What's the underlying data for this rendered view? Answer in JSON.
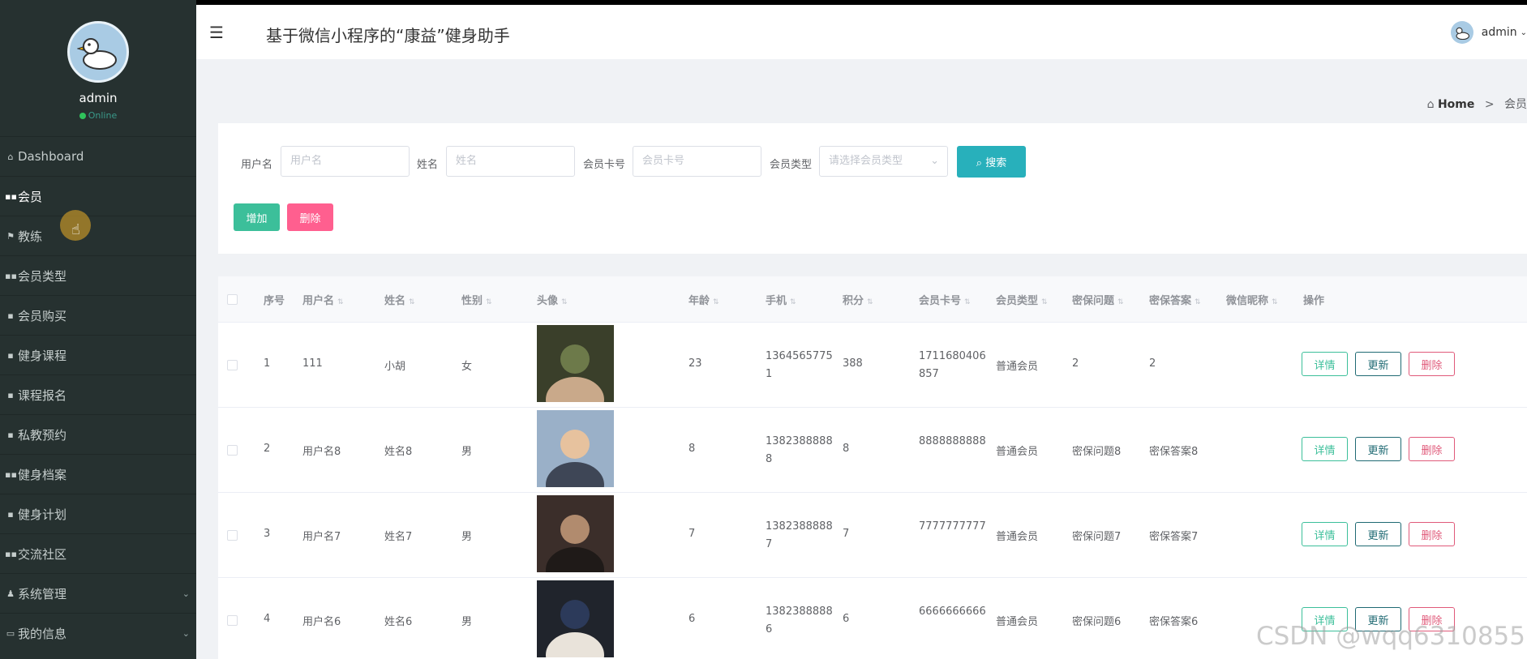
{
  "app": {
    "title": "基于微信小程序的“康益”健身助手",
    "user": "admin",
    "status": "Online",
    "watermark": "CSDN @wqq6310855"
  },
  "breadcrumb": {
    "home": "Home",
    "sep": ">",
    "current": "会员"
  },
  "sidebar": {
    "items": [
      {
        "label": "Dashboard",
        "icon": "home-icon",
        "glyph": "⌂"
      },
      {
        "label": "会员",
        "icon": "grid-icon",
        "glyph": "▪▪"
      },
      {
        "label": "教练",
        "icon": "flag-icon",
        "glyph": "⚑"
      },
      {
        "label": "会员类型",
        "icon": "grid-icon",
        "glyph": "▪▪"
      },
      {
        "label": "会员购买",
        "icon": "doc-icon",
        "glyph": "▪"
      },
      {
        "label": "健身课程",
        "icon": "chat-icon",
        "glyph": "▪"
      },
      {
        "label": "课程报名",
        "icon": "doc-icon",
        "glyph": "▪"
      },
      {
        "label": "私教预约",
        "icon": "pen-icon",
        "glyph": "▪"
      },
      {
        "label": "健身档案",
        "icon": "grid-icon",
        "glyph": "▪▪"
      },
      {
        "label": "健身计划",
        "icon": "lock-icon",
        "glyph": "▪"
      },
      {
        "label": "交流社区",
        "icon": "grid-icon",
        "glyph": "▪▪"
      },
      {
        "label": "系统管理",
        "icon": "user-icon",
        "glyph": "♟"
      },
      {
        "label": "我的信息",
        "icon": "card-icon",
        "glyph": "▭"
      }
    ]
  },
  "search": {
    "username_label": "用户名",
    "username_placeholder": "用户名",
    "name_label": "姓名",
    "name_placeholder": "姓名",
    "card_label": "会员卡号",
    "card_placeholder": "会员卡号",
    "type_label": "会员类型",
    "type_placeholder": "请选择会员类型",
    "search_button": "搜索",
    "add_button": "增加",
    "delete_button": "删除"
  },
  "table": {
    "headers": [
      "序号",
      "用户名",
      "姓名",
      "性别",
      "头像",
      "年龄",
      "手机",
      "积分",
      "会员卡号",
      "会员类型",
      "密保问题",
      "密保答案",
      "微信昵称",
      "操作"
    ],
    "actions": {
      "detail": "详情",
      "update": "更新",
      "delete": "删除"
    },
    "rows": [
      {
        "no": "1",
        "username": "111",
        "name": "小胡",
        "gender": "女",
        "age": "23",
        "phone": "13645657751",
        "points": "388",
        "card": "1711680406857",
        "type": "普通会员",
        "question": "2",
        "answer": "2",
        "wechat": ""
      },
      {
        "no": "2",
        "username": "用户名8",
        "name": "姓名8",
        "gender": "男",
        "age": "8",
        "phone": "13823888888",
        "points": "8",
        "card": "8888888888",
        "type": "普通会员",
        "question": "密保问题8",
        "answer": "密保答案8",
        "wechat": ""
      },
      {
        "no": "3",
        "username": "用户名7",
        "name": "姓名7",
        "gender": "男",
        "age": "7",
        "phone": "13823888887",
        "points": "7",
        "card": "7777777777",
        "type": "普通会员",
        "question": "密保问题7",
        "answer": "密保答案7",
        "wechat": ""
      },
      {
        "no": "4",
        "username": "用户名6",
        "name": "姓名6",
        "gender": "男",
        "age": "6",
        "phone": "13823888886",
        "points": "6",
        "card": "6666666666",
        "type": "普通会员",
        "question": "密保问题6",
        "answer": "密保答案6",
        "wechat": ""
      }
    ]
  }
}
